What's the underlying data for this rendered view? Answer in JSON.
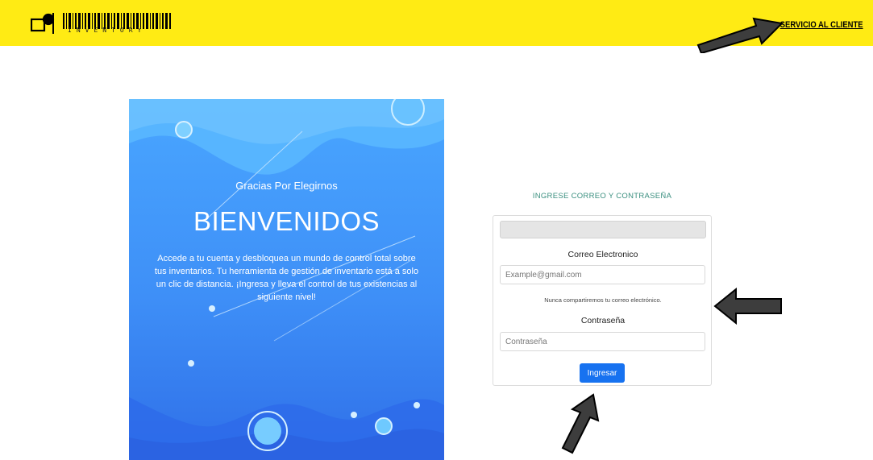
{
  "header": {
    "logo_word": "INVENTORY",
    "service_link": "SERVICIO AL CLIENTE",
    "background_color": "#ffeb14"
  },
  "hero": {
    "tagline": "Gracias Por Elegirnos",
    "title": "BIENVENIDOS",
    "description": "Accede a tu cuenta y desbloquea un mundo de control total sobre tus inventarios. Tu herramienta de gestión de inventario está a solo un clic de distancia. ¡Ingresa y lleva el control de tus existencias al siguiente nivel!",
    "gradient_top": "#49a6ff",
    "gradient_bottom": "#2f6fe8"
  },
  "login": {
    "heading": "INGRESE CORREO Y CONTRASEÑA",
    "email_label": "Correo Electronico",
    "email_placeholder": "Example@gmail.com",
    "email_help": "Nunca compartiremos tu correo electrónico.",
    "password_label": "Contraseña",
    "password_placeholder": "Contraseña",
    "submit_label": "Ingresar",
    "accent_color": "#1772f0"
  },
  "icons": {
    "logo": "barcode-icon",
    "arrows": [
      "arrow-pointer-icon"
    ]
  }
}
